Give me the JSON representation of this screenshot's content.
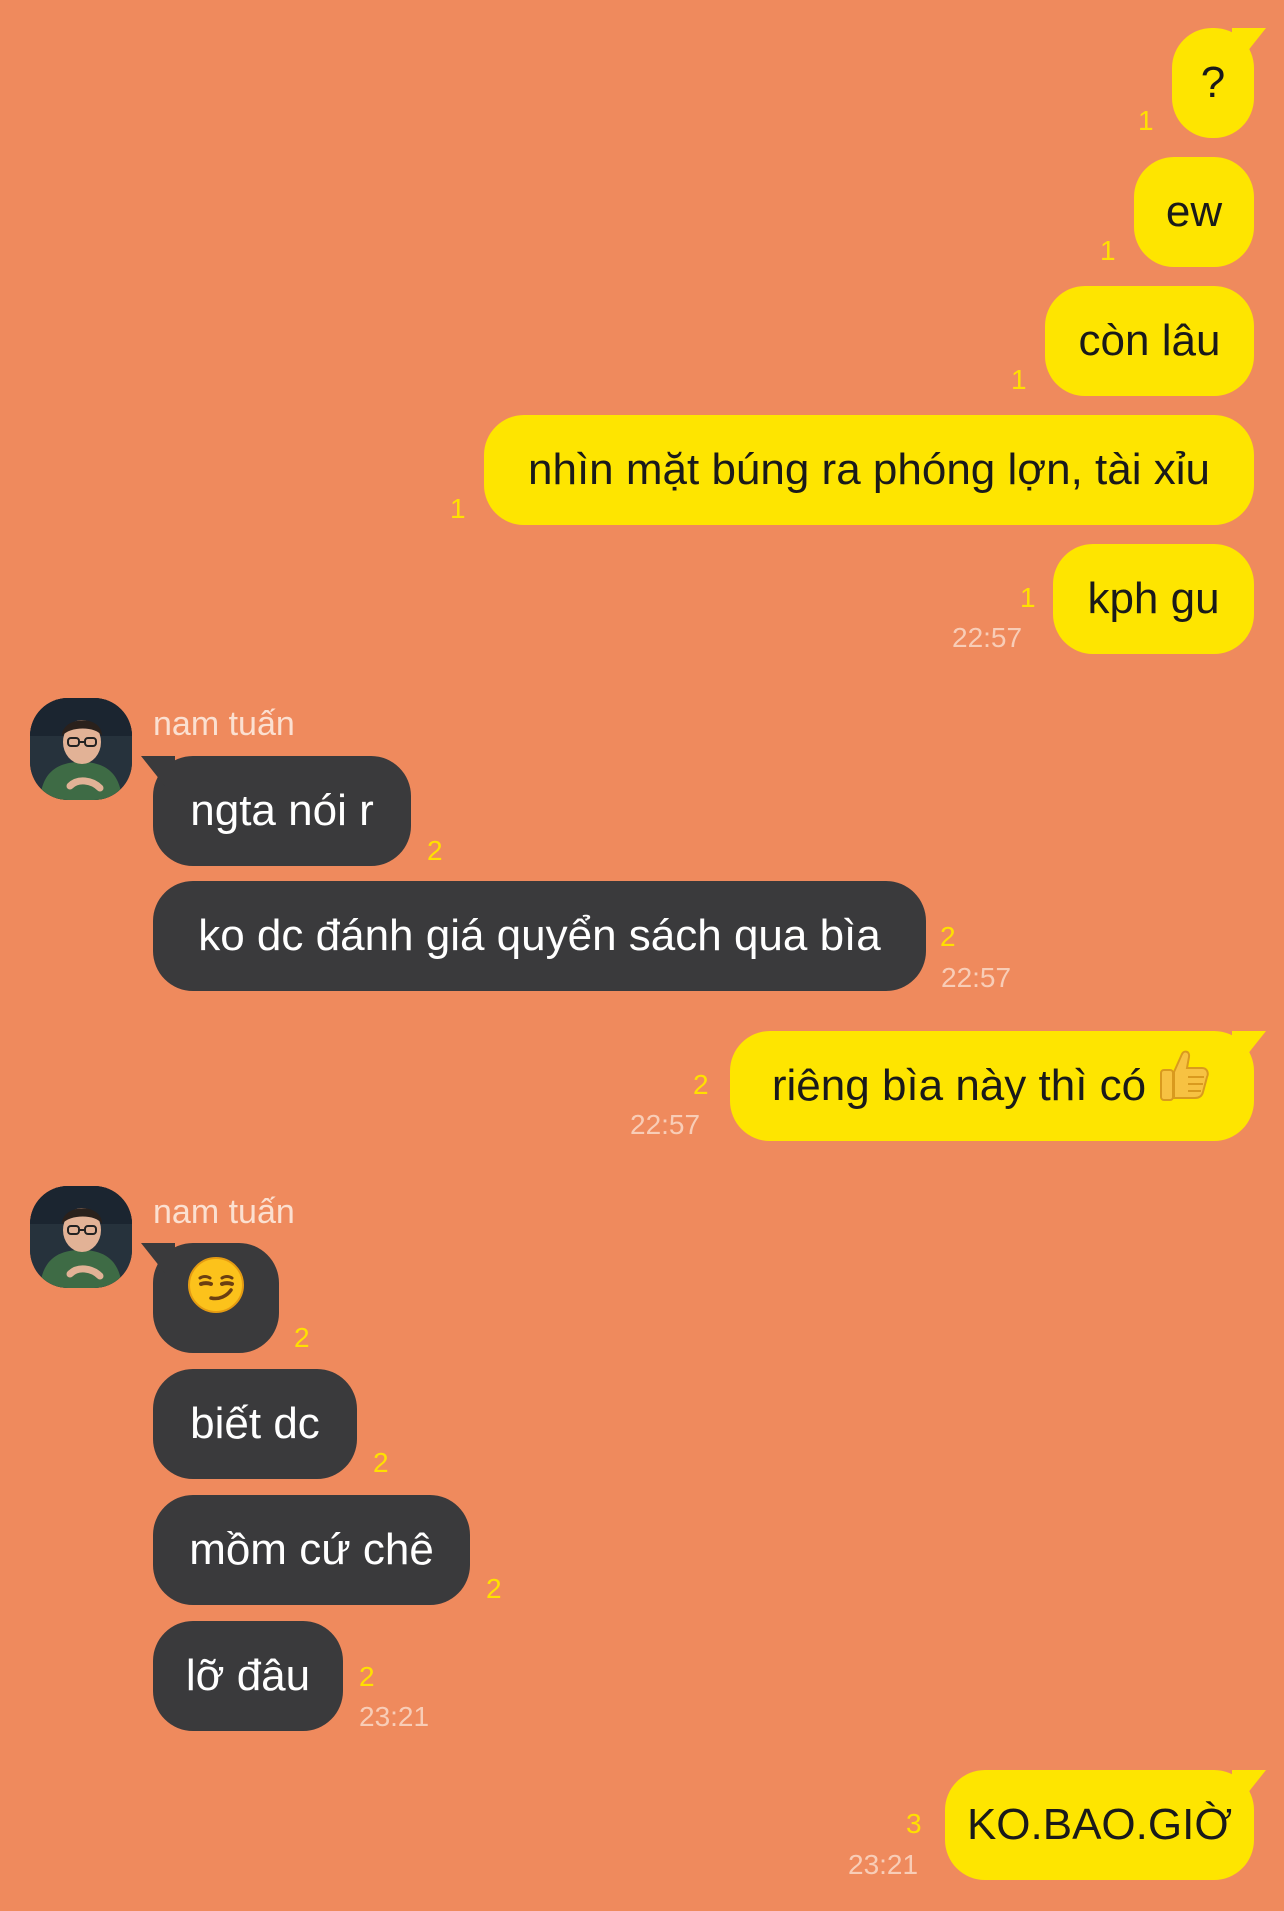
{
  "colors": {
    "background": "#EF8A5D",
    "outgoing_bubble": "#FEE500",
    "incoming_bubble": "#3A3A3C",
    "unread_count": "#FFE000",
    "timestamp": "#F8CDB7"
  },
  "messages": [
    {
      "direction": "out",
      "text": "?",
      "unread": "1"
    },
    {
      "direction": "out",
      "text": "ew",
      "unread": "1"
    },
    {
      "direction": "out",
      "text": "còn lâu",
      "unread": "1"
    },
    {
      "direction": "out",
      "text": "nhìn mặt búng ra phóng lợn, tài xỉu",
      "unread": "1"
    },
    {
      "direction": "out",
      "text": "kph gu",
      "unread": "1",
      "time": "22:57"
    },
    {
      "direction": "in",
      "sender": "nam tuấn",
      "text": "ngta nói r",
      "unread": "2"
    },
    {
      "direction": "in",
      "text": "ko dc đánh giá quyển sách qua bìa",
      "unread": "2",
      "time": "22:57"
    },
    {
      "direction": "out",
      "text": "riêng bìa này thì có",
      "emoji": "thumbs-up",
      "unread": "2",
      "time": "22:57"
    },
    {
      "direction": "in",
      "sender": "nam tuấn",
      "text": "",
      "emoji": "smirking-face",
      "unread": "2"
    },
    {
      "direction": "in",
      "text": "biết dc",
      "unread": "2"
    },
    {
      "direction": "in",
      "text": "mồm cứ chê",
      "unread": "2"
    },
    {
      "direction": "in",
      "text": "lỡ đâu",
      "unread": "2",
      "time": "23:21"
    },
    {
      "direction": "out",
      "text": "KO.BAO.GIỜ",
      "unread": "3",
      "time": "23:21"
    }
  ]
}
